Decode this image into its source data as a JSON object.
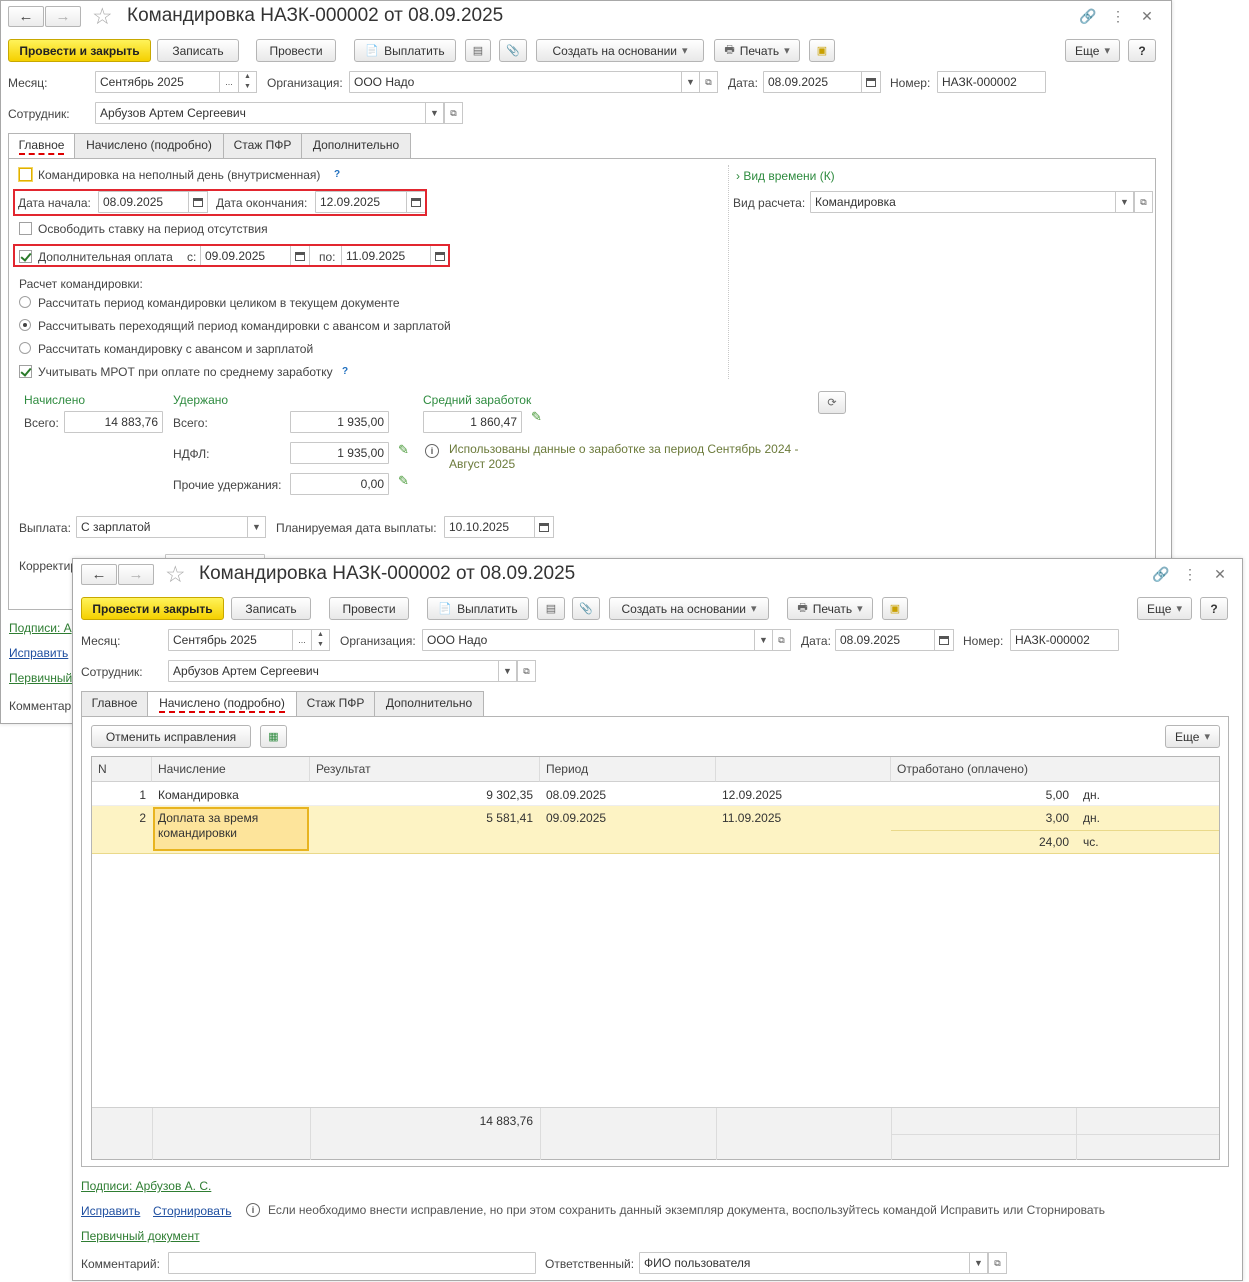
{
  "bg": {
    "title": "Командировка НАЗК-000002 от 08.09.2025",
    "toolbar": {
      "post_close": "Провести и закрыть",
      "save": "Записать",
      "post": "Провести",
      "pay": "Выплатить",
      "create_based": "Создать на основании",
      "print": "Печать",
      "more": "Еще",
      "help": "?"
    },
    "month_label": "Месяц:",
    "month_value": "Сентябрь 2025",
    "org_label": "Организация:",
    "org_value": "ООО Надо",
    "date_label": "Дата:",
    "date_value": "08.09.2025",
    "num_label": "Номер:",
    "num_value": "НАЗК-000002",
    "emp_label": "Сотрудник:",
    "emp_value": "Арбузов Артем Сергеевич",
    "tabs": [
      "Главное",
      "Начислено (подробно)",
      "Стаж ПФР",
      "Дополнительно"
    ],
    "partial_day": "Командировка на неполный день (внутрисменная)",
    "start_label": "Дата начала:",
    "start_value": "08.09.2025",
    "end_label": "Дата окончания:",
    "end_value": "12.09.2025",
    "free_rate": "Освободить ставку на период отсутствия",
    "extra_pay": "Дополнительная оплата",
    "from_label": "с:",
    "from_value": "09.09.2025",
    "to_label": "по:",
    "to_value": "11.09.2025",
    "calc_title": "Расчет командировки:",
    "radio1": "Рассчитать период командировки целиком в текущем документе",
    "radio2": "Рассчитывать переходящий период командировки с авансом и зарплатой",
    "radio3": "Рассчитать командировку с авансом и зарплатой",
    "mrot": "Учитывать МРОТ при оплате по среднему заработку",
    "time_kind": "Вид времени (К)",
    "calc_kind_label": "Вид расчета:",
    "calc_kind_value": "Командировка",
    "accrued_title": "Начислено",
    "accrued_total_label": "Всего:",
    "accrued_total": "14 883,76",
    "withheld_title": "Удержано",
    "withheld_total_label": "Всего:",
    "withheld_total": "1 935,00",
    "ndfl_label": "НДФЛ:",
    "ndfl_value": "1 935,00",
    "other_label": "Прочие удержания:",
    "other_value": "0,00",
    "avg_title": "Средний заработок",
    "avg_value": "1 860,47",
    "avg_note": "Использованы данные о заработке за период Сентябрь 2024 - Август 2025",
    "payout_label": "Выплата:",
    "payout_value": "С зарплатой",
    "plan_date_label": "Планируемая дата выплаты:",
    "plan_date_value": "10.10.2025",
    "correct_label": "Корректир",
    "signatures": "Подписи: А",
    "fix": "Исправить",
    "primary": "Первичный",
    "comment": "Комментар"
  },
  "fg": {
    "title": "Командировка НАЗК-000002 от 08.09.2025",
    "toolbar": {
      "post_close": "Провести и закрыть",
      "save": "Записать",
      "post": "Провести",
      "pay": "Выплатить",
      "create_based": "Создать на основании",
      "print": "Печать",
      "more": "Еще",
      "help": "?"
    },
    "month_label": "Месяц:",
    "month_value": "Сентябрь 2025",
    "org_label": "Организация:",
    "org_value": "ООО Надо",
    "date_label": "Дата:",
    "date_value": "08.09.2025",
    "num_label": "Номер:",
    "num_value": "НАЗК-000002",
    "emp_label": "Сотрудник:",
    "emp_value": "Арбузов Артем Сергеевич",
    "tabs": [
      "Главное",
      "Начислено (подробно)",
      "Стаж ПФР",
      "Дополнительно"
    ],
    "cancel_fix": "Отменить исправления",
    "more": "Еще",
    "table": {
      "headers": [
        "N",
        "Начисление",
        "Результат",
        "Период",
        "",
        "Отработано (оплачено)"
      ],
      "rows": [
        {
          "n": "1",
          "name": "Командировка",
          "result": "9 302,35",
          "from": "08.09.2025",
          "to": "12.09.2025",
          "worked": "5,00",
          "unit": "дн."
        },
        {
          "n": "2",
          "name": "Доплата за время командировки",
          "result": "5 581,41",
          "from": "09.09.2025",
          "to": "11.09.2025",
          "worked": "3,00",
          "unit": "дн.",
          "worked2": "24,00",
          "unit2": "чс."
        }
      ],
      "total_result": "14 883,76"
    },
    "signatures": "Подписи: Арбузов А. С.",
    "fix": "Исправить",
    "storno": "Сторнировать",
    "fix_note": "Если необходимо внести исправление, но при этом сохранить данный экземпляр документа, воспользуйтесь командой Исправить или Сторнировать",
    "primary": "Первичный документ",
    "comment_label": "Комментарий:",
    "comment_value": "",
    "resp_label": "Ответственный:",
    "resp_value": "ФИО пользователя"
  },
  "colors": {
    "accent_yellow": "#f5d000",
    "link_green": "#2e7d32",
    "highlight_red": "#e2262f",
    "row_highlight": "#fdf3c4"
  },
  "icons": [
    "back-arrow-icon",
    "forward-arrow-icon",
    "star-icon",
    "link-icon",
    "kebab-menu-icon",
    "close-icon",
    "calendar-icon",
    "dropdown-arrow-icon",
    "open-icon",
    "pencil-icon",
    "info-icon",
    "refresh-icon",
    "printer-icon",
    "paperclip-icon",
    "document-icon"
  ]
}
